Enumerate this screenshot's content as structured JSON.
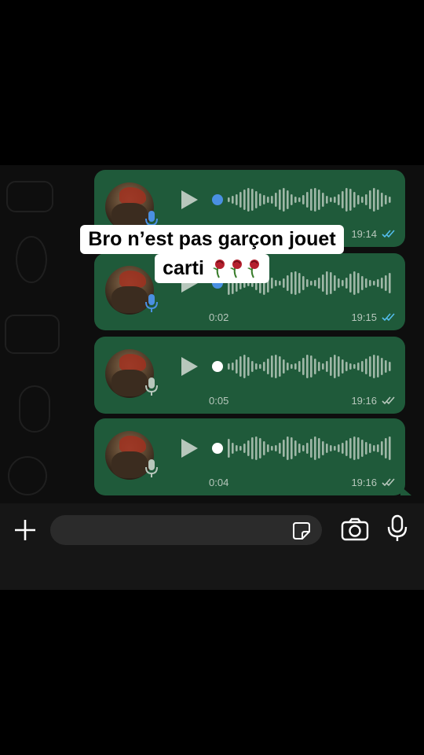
{
  "colors": {
    "bubble": "#1f5a3a",
    "text_muted": "#b7c7bc",
    "accent_blue": "#4a90e2",
    "tick_blue": "#53bdeb"
  },
  "caption": {
    "line1": "Bro n’est pas garçon jouet",
    "line2": "carti",
    "emoji": [
      "wilted-rose",
      "wilted-rose",
      "wilted-rose"
    ]
  },
  "messages": [
    {
      "duration": "",
      "time": "19:14",
      "status": "read",
      "played": false,
      "mic_color": "blue"
    },
    {
      "duration": "0:02",
      "time": "19:15",
      "status": "read",
      "played": false,
      "mic_color": "blue"
    },
    {
      "duration": "0:05",
      "time": "19:16",
      "status": "delivered",
      "played": true,
      "mic_color": "grey"
    },
    {
      "duration": "0:04",
      "time": "19:16",
      "status": "delivered",
      "played": true,
      "mic_color": "grey"
    }
  ],
  "composer": {
    "placeholder": "",
    "icons": [
      "plus-icon",
      "sticker-icon",
      "camera-icon",
      "mic-icon"
    ]
  }
}
